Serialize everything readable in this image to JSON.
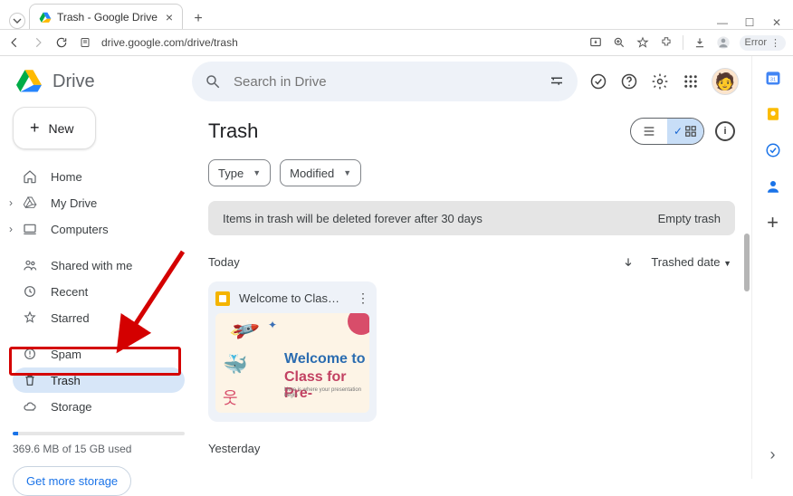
{
  "browser": {
    "tab_title": "Trash - Google Drive",
    "url": "drive.google.com/drive/trash",
    "error_label": "Error"
  },
  "brand": {
    "name": "Drive"
  },
  "new_button": "New",
  "nav": {
    "home": "Home",
    "mydrive": "My Drive",
    "computers": "Computers",
    "shared": "Shared with me",
    "recent": "Recent",
    "starred": "Starred",
    "spam": "Spam",
    "trash": "Trash",
    "storage": "Storage"
  },
  "storage": {
    "text": "369.6 MB of 15 GB used",
    "cta": "Get more storage"
  },
  "search": {
    "placeholder": "Search in Drive"
  },
  "page": {
    "title": "Trash"
  },
  "filters": {
    "type": "Type",
    "modified": "Modified"
  },
  "notice": {
    "text": "Items in trash will be deleted forever after 30 days",
    "action": "Empty trash"
  },
  "sections": {
    "today": "Today",
    "yesterday": "Yesterday"
  },
  "sort": {
    "label": "Trashed date"
  },
  "card": {
    "title": "Welcome to Clas…",
    "line1": "Welcome to",
    "line2": "Class for Pre-",
    "line3": "Here is where your presentation begin"
  }
}
